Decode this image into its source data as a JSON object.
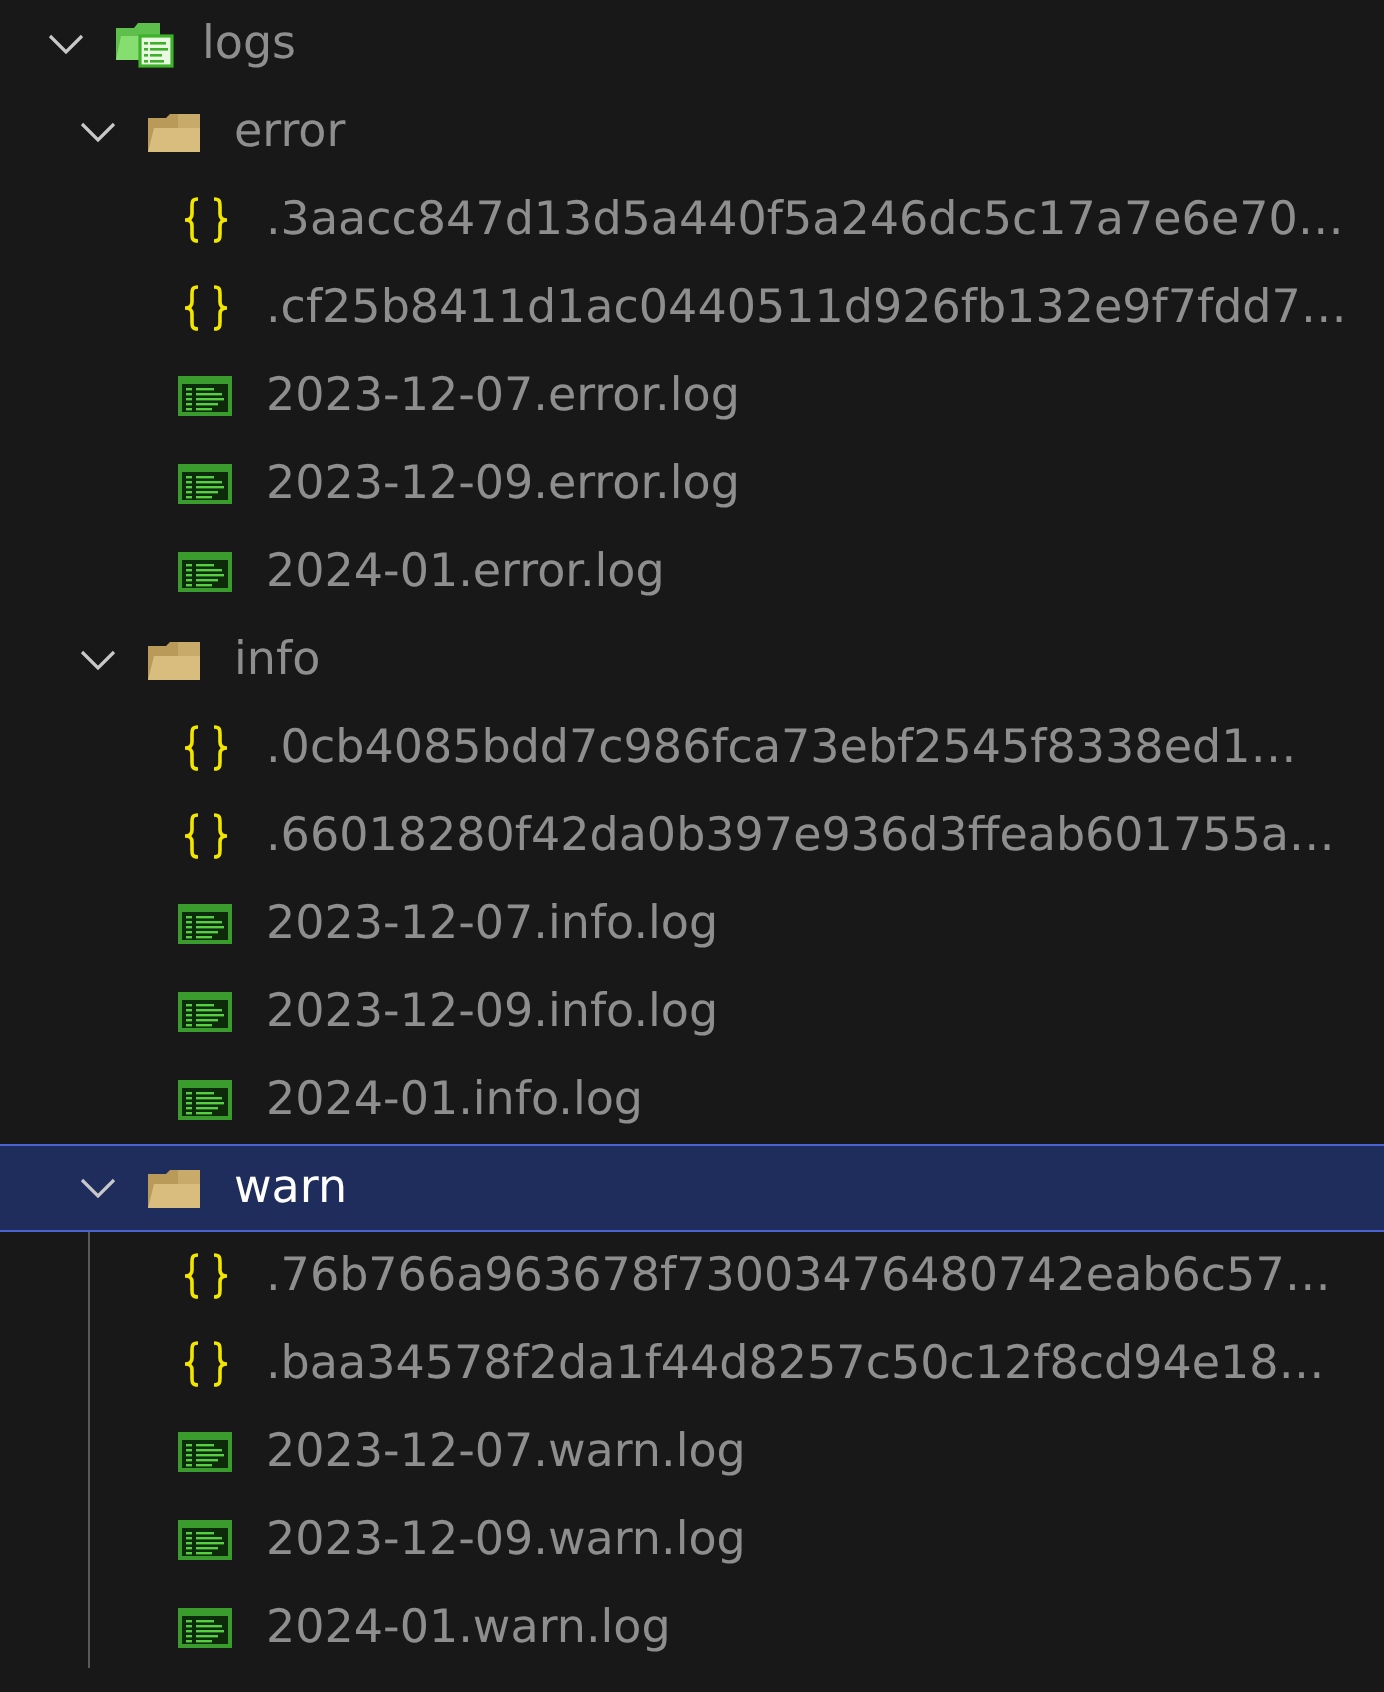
{
  "tree": [
    {
      "name": "logs",
      "kind": "logfolder",
      "expanded": true,
      "selected": false,
      "children": [
        {
          "name": "error",
          "kind": "folder",
          "expanded": true,
          "selected": false,
          "children": [
            {
              "name": ".3aacc847d13d5a440f5a246dc5c17a7e6e70…",
              "kind": "json",
              "selected": false
            },
            {
              "name": ".cf25b8411d1ac0440511d926fb132e9f7fdd7…",
              "kind": "json",
              "selected": false
            },
            {
              "name": "2023-12-07.error.log",
              "kind": "log",
              "selected": false
            },
            {
              "name": "2023-12-09.error.log",
              "kind": "log",
              "selected": false
            },
            {
              "name": "2024-01.error.log",
              "kind": "log",
              "selected": false
            }
          ]
        },
        {
          "name": "info",
          "kind": "folder",
          "expanded": true,
          "selected": false,
          "children": [
            {
              "name": ".0cb4085bdd7c986fca73ebf2545f8338ed1…",
              "kind": "json",
              "selected": false
            },
            {
              "name": ".66018280f42da0b397e936d3ffeab601755a…",
              "kind": "json",
              "selected": false
            },
            {
              "name": "2023-12-07.info.log",
              "kind": "log",
              "selected": false
            },
            {
              "name": "2023-12-09.info.log",
              "kind": "log",
              "selected": false
            },
            {
              "name": "2024-01.info.log",
              "kind": "log",
              "selected": false
            }
          ]
        },
        {
          "name": "warn",
          "kind": "folder",
          "expanded": true,
          "selected": true,
          "children": [
            {
              "name": ".76b766a963678f73003476480742eab6c57…",
              "kind": "json",
              "selected": false
            },
            {
              "name": ".baa34578f2da1f44d8257c50c12f8cd94e18…",
              "kind": "json",
              "selected": false
            },
            {
              "name": "2023-12-07.warn.log",
              "kind": "log",
              "selected": false
            },
            {
              "name": "2023-12-09.warn.log",
              "kind": "log",
              "selected": false
            },
            {
              "name": "2024-01.warn.log",
              "kind": "log",
              "selected": false
            }
          ]
        }
      ]
    }
  ]
}
